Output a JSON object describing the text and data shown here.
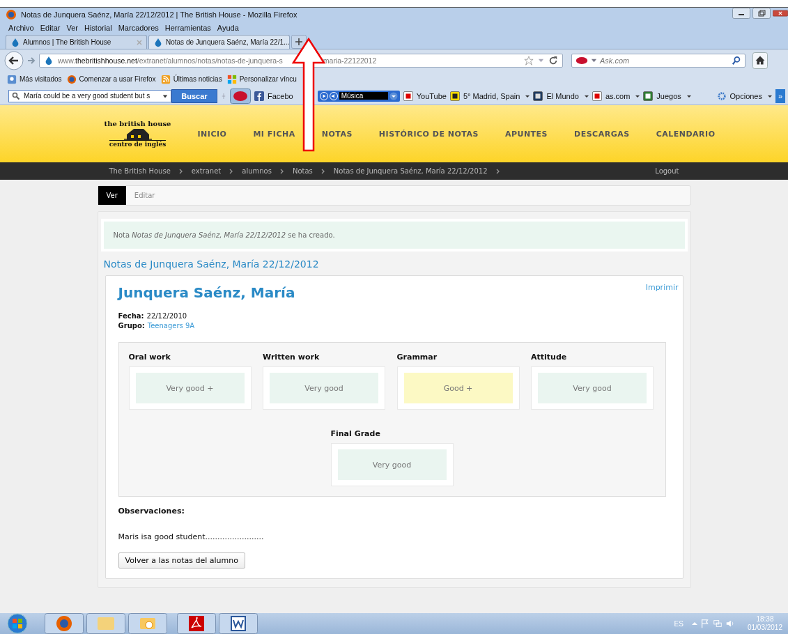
{
  "window": {
    "title": "Notas de Junquera Saénz, María 22/12/2012 | The British House - Mozilla Firefox"
  },
  "menu": [
    "Archivo",
    "Editar",
    "Ver",
    "Historial",
    "Marcadores",
    "Herramientas",
    "Ayuda"
  ],
  "tabs": [
    {
      "label": "Alumnos | The British House",
      "selected": false
    },
    {
      "label": "Notas de Junquera Saénz, María 22/1...",
      "selected": true
    }
  ],
  "nav": {
    "url_host": "www.thebritishhouse.net",
    "url_path": "/extranet/alumnos/notas/notas-de-junquera-s",
    "url_tail": "maria-22122012",
    "search_placeholder": "Ask.com"
  },
  "bookmarks": [
    "Más visitados",
    "Comenzar a usar Firefox",
    "Últimas noticias",
    "Personalizar víncu"
  ],
  "toolbar": {
    "search_value": "María could be a very good student but s",
    "search_button": "Buscar",
    "facebook": "Facebo",
    "radio": "Música",
    "items": [
      "YouTube",
      "5° Madrid, Spain",
      "El Mundo",
      "as.com",
      "Juegos"
    ],
    "options": "Opciones",
    "more": "»"
  },
  "site": {
    "logo_top": "the british house",
    "logo_bottom": "centro de inglés",
    "nav": [
      "INICIO",
      "MI FICHA",
      "NOTAS",
      "HISTÓRICO DE NOTAS",
      "APUNTES",
      "DESCARGAS",
      "CALENDARIO"
    ],
    "breadcrumb": [
      "The British House",
      "extranet",
      "alumnos",
      "Notas",
      "Notas de Junquera Saénz, María 22/12/2012"
    ],
    "logout": "Logout"
  },
  "page_tabs": [
    {
      "label": "Ver",
      "selected": true
    },
    {
      "label": "Editar",
      "selected": false
    }
  ],
  "message": "Nota *Notas de Junquera Saénz, María 22/12/2012* se ha creado.",
  "heading": "Notas de Junquera Saénz, María 22/12/2012",
  "card": {
    "print": "Imprimir",
    "name": "Junquera Saénz, María",
    "fields": [
      {
        "label": "Fecha:",
        "value": "22/12/2010",
        "link": false
      },
      {
        "label": "Grupo:",
        "value": "Teenagers 9A",
        "link": true
      }
    ],
    "grades": [
      {
        "label": "Oral work",
        "value": "Very good +",
        "color": "#eaf5f0"
      },
      {
        "label": "Written work",
        "value": "Very good",
        "color": "#eaf5f0"
      },
      {
        "label": "Grammar",
        "value": "Good +",
        "color": "#fcf9c4"
      },
      {
        "label": "Attitude",
        "value": "Very good",
        "color": "#eaf5f0"
      }
    ],
    "final": {
      "label": "Final Grade",
      "value": "Very good",
      "color": "#eaf5f0"
    },
    "observations_label": "Observaciones:",
    "observations": "Maris isa good student........................",
    "back_button": "Volver a las notas del alumno"
  },
  "taskbar": {
    "language": "ES",
    "time": "18:38",
    "date": "01/03/2012"
  }
}
